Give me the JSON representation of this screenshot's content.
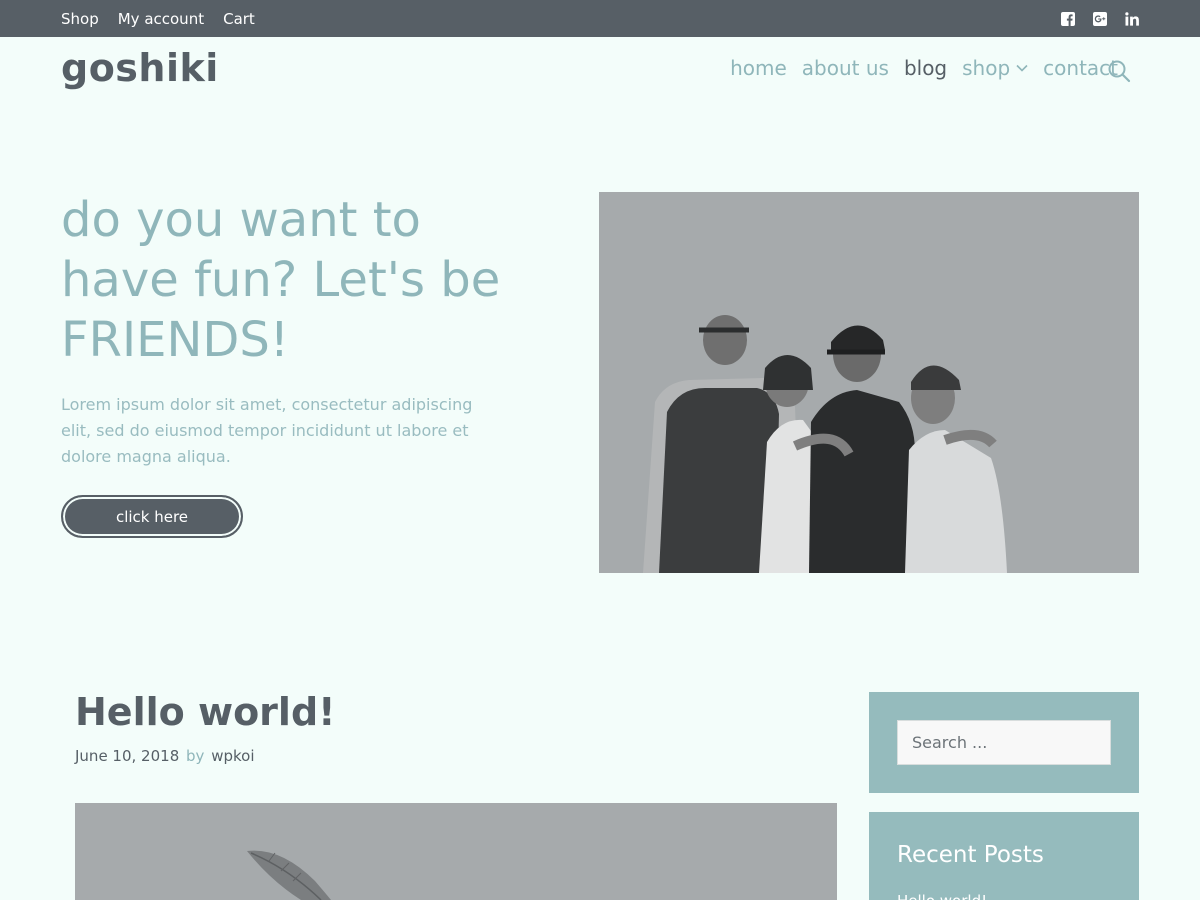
{
  "topbar": {
    "links": [
      "Shop",
      "My account",
      "Cart"
    ],
    "social": [
      "facebook-icon",
      "google-plus-icon",
      "linkedin-icon"
    ]
  },
  "header": {
    "site_title": "goshiki",
    "nav": [
      {
        "label": "home"
      },
      {
        "label": "about us"
      },
      {
        "label": "blog",
        "current": true
      },
      {
        "label": "shop",
        "has_dropdown": true
      },
      {
        "label": "contact"
      }
    ],
    "search_icon": "search-icon"
  },
  "hero": {
    "heading": "do you want to have fun? Let's be FRIENDS!",
    "text": "Lorem ipsum dolor sit amet, consectetur adipiscing elit, sed do eiusmod tempor incididunt ut labore et dolore magna aliqua.",
    "button_label": "click here"
  },
  "post": {
    "title": "Hello world!",
    "date": "June 10, 2018",
    "by": "by",
    "author": "wpkoi"
  },
  "sidebar": {
    "search_placeholder": "Search ...",
    "recent_title": "Recent Posts",
    "recent_items": [
      "Hello world!"
    ]
  },
  "colors": {
    "background": "#f3fdfa",
    "topbar": "#575f66",
    "accent": "#8fb6ba",
    "dark_text": "#565f66",
    "widget_bg": "#95bbbd"
  }
}
